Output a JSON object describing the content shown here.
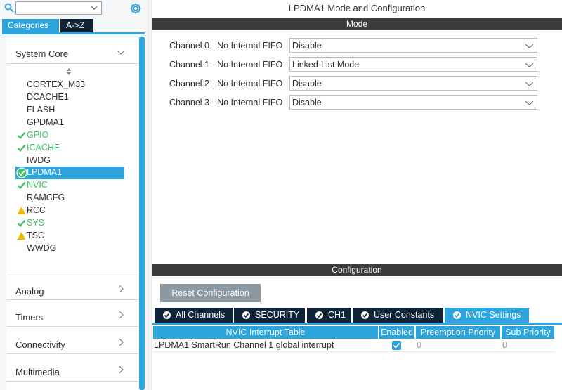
{
  "sidebar": {
    "search": {
      "value": "",
      "placeholder": ""
    },
    "tabs": [
      {
        "label": "Categories"
      },
      {
        "label": "A->Z"
      }
    ],
    "categories": [
      {
        "label": "System Core"
      },
      {
        "label": "Analog"
      },
      {
        "label": "Timers"
      },
      {
        "label": "Connectivity"
      },
      {
        "label": "Multimedia"
      }
    ],
    "peripherals": [
      {
        "name": "CORTEX_M33",
        "status": "none"
      },
      {
        "name": "DCACHE1",
        "status": "none"
      },
      {
        "name": "FLASH",
        "status": "none"
      },
      {
        "name": "GPDMA1",
        "status": "none"
      },
      {
        "name": "GPIO",
        "status": "ok"
      },
      {
        "name": "ICACHE",
        "status": "ok"
      },
      {
        "name": "IWDG",
        "status": "none"
      },
      {
        "name": "LPDMA1",
        "status": "selected"
      },
      {
        "name": "NVIC",
        "status": "ok"
      },
      {
        "name": "RAMCFG",
        "status": "none"
      },
      {
        "name": "RCC",
        "status": "warning"
      },
      {
        "name": "SYS",
        "status": "ok"
      },
      {
        "name": "TSC",
        "status": "warning"
      },
      {
        "name": "WWDG",
        "status": "none"
      }
    ]
  },
  "main": {
    "title": "LPDMA1 Mode and Configuration",
    "mode_header": "Mode",
    "channels": [
      {
        "label": "Channel 0  - No Internal FIFO",
        "value": "Disable"
      },
      {
        "label": "Channel 1  - No Internal FIFO",
        "value": "Linked-List Mode"
      },
      {
        "label": "Channel 2  - No Internal FIFO",
        "value": "Disable"
      },
      {
        "label": "Channel 3  - No Internal FIFO",
        "value": "Disable"
      }
    ],
    "config_header": "Configuration",
    "reset_label": "Reset Configuration",
    "param_tabs": [
      {
        "label": "All Channels"
      },
      {
        "label": "SECURITY"
      },
      {
        "label": "CH1"
      },
      {
        "label": "User Constants"
      },
      {
        "label": "NVIC Settings"
      }
    ],
    "nvic_table": {
      "columns": [
        "NVIC Interrupt Table",
        "Enabled",
        "Preemption Priority",
        "Sub Priority"
      ],
      "rows": [
        {
          "name": "LPDMA1 SmartRun Channel 1 global interrupt",
          "enabled": true,
          "preemption": "0",
          "sub": "0"
        }
      ]
    }
  },
  "colors": {
    "accent": "#2da4dc",
    "dark": "#0f2537",
    "header": "#3c3c3c",
    "ok": "#3fbf67",
    "warning": "#f2b705"
  }
}
